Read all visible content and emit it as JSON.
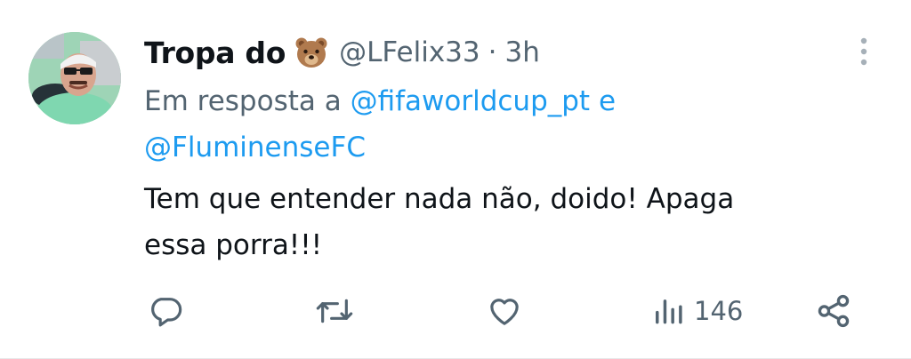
{
  "tweet": {
    "display_name": "Tropa do",
    "name_emoji": "bear-face-emoji",
    "handle": "@LFelix33",
    "separator": "·",
    "time": "3h",
    "reply_prefix": "Em resposta a",
    "reply_mentions": [
      "@fifaworldcup_pt",
      "@FluminenseFC"
    ],
    "reply_joiner": "e",
    "text_line1": "Tem que entender nada não, doido! Apaga",
    "text_line2": "essa porra!!!"
  },
  "actions": {
    "reply_icon": "reply-icon",
    "retweet_icon": "retweet-icon",
    "like_icon": "heart-icon",
    "views_icon": "views-icon",
    "views_count": "146",
    "share_icon": "share-icon"
  },
  "colors": {
    "accent": "#1d9bf0",
    "secondary_text": "#536471",
    "primary_text": "#0f1419"
  }
}
